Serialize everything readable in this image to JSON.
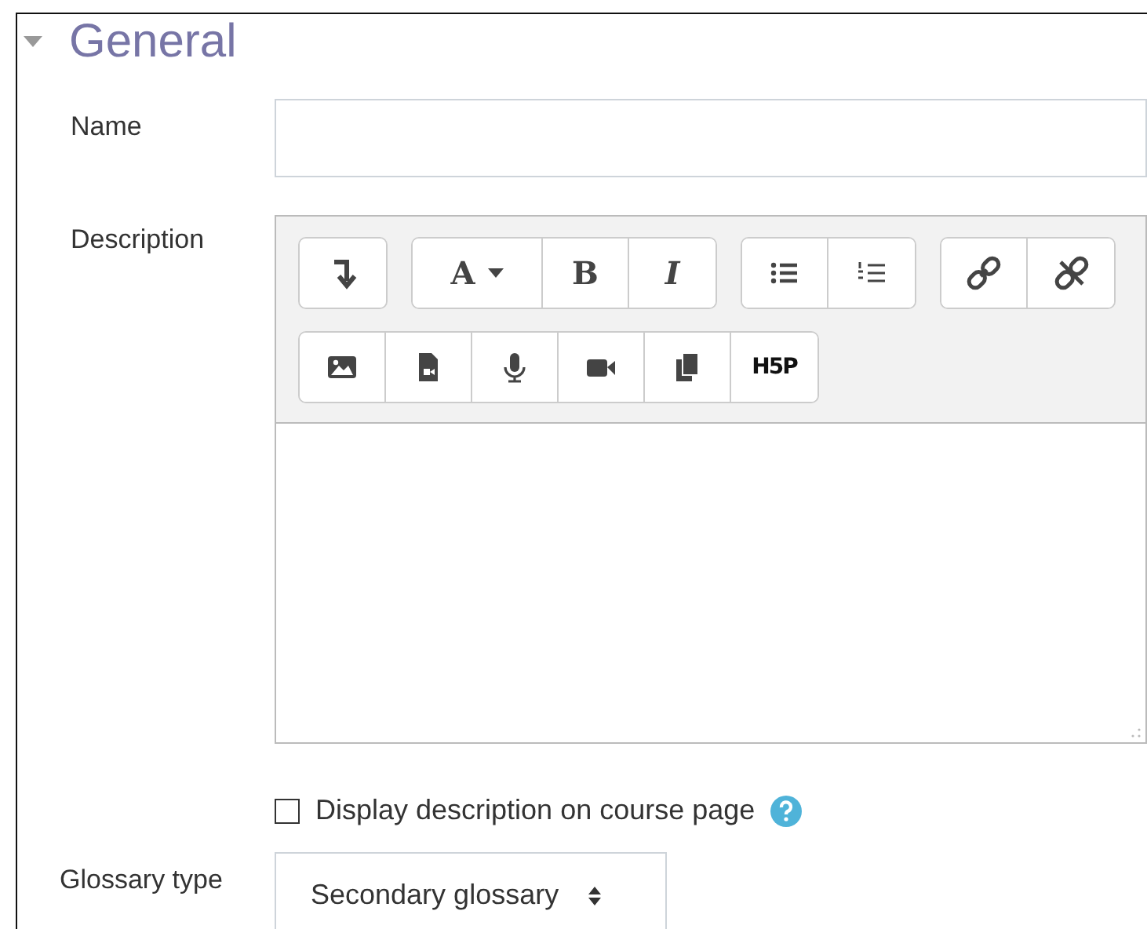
{
  "section": {
    "title": "General",
    "expanded": true
  },
  "name_field": {
    "label": "Name"
  },
  "description": {
    "label": "Description",
    "toolbar_rows": [
      [
        {
          "buttons": [
            {
              "kind": "collapse"
            }
          ]
        },
        {
          "buttons": [
            {
              "kind": "text",
              "label": "A",
              "caret": true
            },
            {
              "kind": "text",
              "label": "B"
            },
            {
              "kind": "text",
              "label": "I",
              "italic": true
            }
          ]
        },
        {
          "buttons": [
            {
              "kind": "ul"
            },
            {
              "kind": "ol"
            }
          ]
        },
        {
          "buttons": [
            {
              "kind": "link"
            },
            {
              "kind": "unlink"
            }
          ]
        }
      ],
      [
        {
          "buttons": [
            {
              "kind": "image"
            },
            {
              "kind": "media"
            },
            {
              "kind": "mic"
            },
            {
              "kind": "video"
            },
            {
              "kind": "copy"
            },
            {
              "kind": "text",
              "label": "H5P",
              "small": true
            }
          ]
        }
      ]
    ]
  },
  "display_option": {
    "label": "Display description on course page",
    "checked": false
  },
  "glossary_type": {
    "label": "Glossary type",
    "value": "Secondary glossary"
  }
}
